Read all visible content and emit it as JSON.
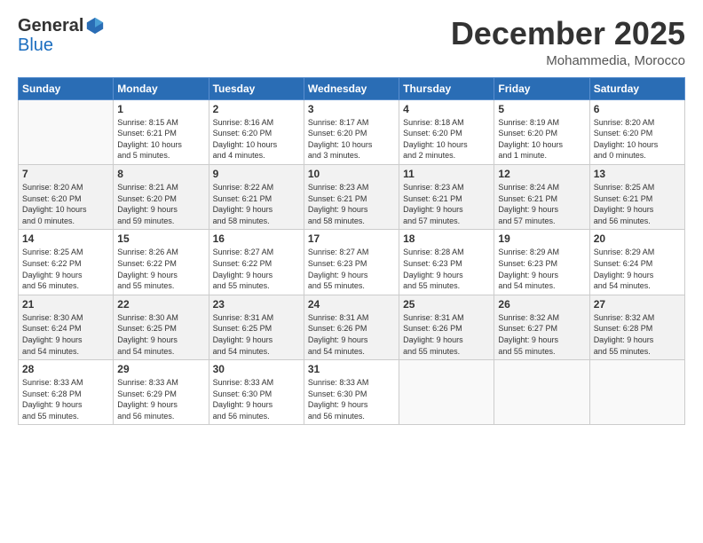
{
  "header": {
    "logo": {
      "general": "General",
      "blue": "Blue"
    },
    "month": "December 2025",
    "location": "Mohammedia, Morocco"
  },
  "weekdays": [
    "Sunday",
    "Monday",
    "Tuesday",
    "Wednesday",
    "Thursday",
    "Friday",
    "Saturday"
  ],
  "weeks": [
    [
      {
        "day": "",
        "info": ""
      },
      {
        "day": "1",
        "info": "Sunrise: 8:15 AM\nSunset: 6:21 PM\nDaylight: 10 hours\nand 5 minutes."
      },
      {
        "day": "2",
        "info": "Sunrise: 8:16 AM\nSunset: 6:20 PM\nDaylight: 10 hours\nand 4 minutes."
      },
      {
        "day": "3",
        "info": "Sunrise: 8:17 AM\nSunset: 6:20 PM\nDaylight: 10 hours\nand 3 minutes."
      },
      {
        "day": "4",
        "info": "Sunrise: 8:18 AM\nSunset: 6:20 PM\nDaylight: 10 hours\nand 2 minutes."
      },
      {
        "day": "5",
        "info": "Sunrise: 8:19 AM\nSunset: 6:20 PM\nDaylight: 10 hours\nand 1 minute."
      },
      {
        "day": "6",
        "info": "Sunrise: 8:20 AM\nSunset: 6:20 PM\nDaylight: 10 hours\nand 0 minutes."
      }
    ],
    [
      {
        "day": "7",
        "info": "Sunrise: 8:20 AM\nSunset: 6:20 PM\nDaylight: 10 hours\nand 0 minutes."
      },
      {
        "day": "8",
        "info": "Sunrise: 8:21 AM\nSunset: 6:20 PM\nDaylight: 9 hours\nand 59 minutes."
      },
      {
        "day": "9",
        "info": "Sunrise: 8:22 AM\nSunset: 6:21 PM\nDaylight: 9 hours\nand 58 minutes."
      },
      {
        "day": "10",
        "info": "Sunrise: 8:23 AM\nSunset: 6:21 PM\nDaylight: 9 hours\nand 58 minutes."
      },
      {
        "day": "11",
        "info": "Sunrise: 8:23 AM\nSunset: 6:21 PM\nDaylight: 9 hours\nand 57 minutes."
      },
      {
        "day": "12",
        "info": "Sunrise: 8:24 AM\nSunset: 6:21 PM\nDaylight: 9 hours\nand 57 minutes."
      },
      {
        "day": "13",
        "info": "Sunrise: 8:25 AM\nSunset: 6:21 PM\nDaylight: 9 hours\nand 56 minutes."
      }
    ],
    [
      {
        "day": "14",
        "info": "Sunrise: 8:25 AM\nSunset: 6:22 PM\nDaylight: 9 hours\nand 56 minutes."
      },
      {
        "day": "15",
        "info": "Sunrise: 8:26 AM\nSunset: 6:22 PM\nDaylight: 9 hours\nand 55 minutes."
      },
      {
        "day": "16",
        "info": "Sunrise: 8:27 AM\nSunset: 6:22 PM\nDaylight: 9 hours\nand 55 minutes."
      },
      {
        "day": "17",
        "info": "Sunrise: 8:27 AM\nSunset: 6:23 PM\nDaylight: 9 hours\nand 55 minutes."
      },
      {
        "day": "18",
        "info": "Sunrise: 8:28 AM\nSunset: 6:23 PM\nDaylight: 9 hours\nand 55 minutes."
      },
      {
        "day": "19",
        "info": "Sunrise: 8:29 AM\nSunset: 6:23 PM\nDaylight: 9 hours\nand 54 minutes."
      },
      {
        "day": "20",
        "info": "Sunrise: 8:29 AM\nSunset: 6:24 PM\nDaylight: 9 hours\nand 54 minutes."
      }
    ],
    [
      {
        "day": "21",
        "info": "Sunrise: 8:30 AM\nSunset: 6:24 PM\nDaylight: 9 hours\nand 54 minutes."
      },
      {
        "day": "22",
        "info": "Sunrise: 8:30 AM\nSunset: 6:25 PM\nDaylight: 9 hours\nand 54 minutes."
      },
      {
        "day": "23",
        "info": "Sunrise: 8:31 AM\nSunset: 6:25 PM\nDaylight: 9 hours\nand 54 minutes."
      },
      {
        "day": "24",
        "info": "Sunrise: 8:31 AM\nSunset: 6:26 PM\nDaylight: 9 hours\nand 54 minutes."
      },
      {
        "day": "25",
        "info": "Sunrise: 8:31 AM\nSunset: 6:26 PM\nDaylight: 9 hours\nand 55 minutes."
      },
      {
        "day": "26",
        "info": "Sunrise: 8:32 AM\nSunset: 6:27 PM\nDaylight: 9 hours\nand 55 minutes."
      },
      {
        "day": "27",
        "info": "Sunrise: 8:32 AM\nSunset: 6:28 PM\nDaylight: 9 hours\nand 55 minutes."
      }
    ],
    [
      {
        "day": "28",
        "info": "Sunrise: 8:33 AM\nSunset: 6:28 PM\nDaylight: 9 hours\nand 55 minutes."
      },
      {
        "day": "29",
        "info": "Sunrise: 8:33 AM\nSunset: 6:29 PM\nDaylight: 9 hours\nand 56 minutes."
      },
      {
        "day": "30",
        "info": "Sunrise: 8:33 AM\nSunset: 6:30 PM\nDaylight: 9 hours\nand 56 minutes."
      },
      {
        "day": "31",
        "info": "Sunrise: 8:33 AM\nSunset: 6:30 PM\nDaylight: 9 hours\nand 56 minutes."
      },
      {
        "day": "",
        "info": ""
      },
      {
        "day": "",
        "info": ""
      },
      {
        "day": "",
        "info": ""
      }
    ]
  ]
}
